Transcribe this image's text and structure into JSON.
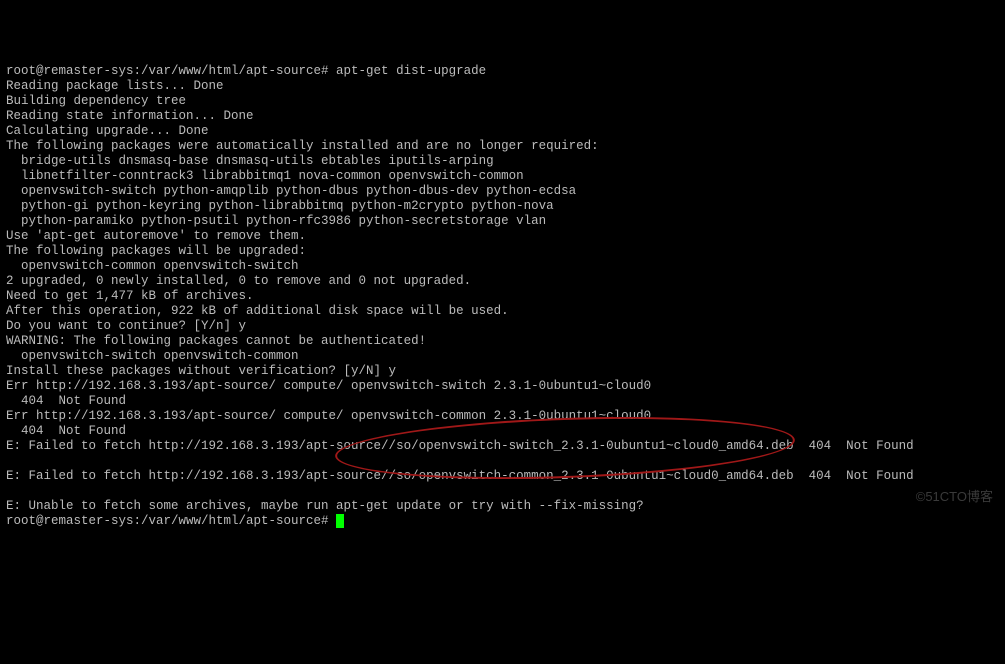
{
  "lines": [
    "root@remaster-sys:/var/www/html/apt-source# apt-get dist-upgrade",
    "Reading package lists... Done",
    "Building dependency tree",
    "Reading state information... Done",
    "Calculating upgrade... Done",
    "The following packages were automatically installed and are no longer required:",
    "  bridge-utils dnsmasq-base dnsmasq-utils ebtables iputils-arping",
    "  libnetfilter-conntrack3 librabbitmq1 nova-common openvswitch-common",
    "  openvswitch-switch python-amqplib python-dbus python-dbus-dev python-ecdsa",
    "  python-gi python-keyring python-librabbitmq python-m2crypto python-nova",
    "  python-paramiko python-psutil python-rfc3986 python-secretstorage vlan",
    "Use 'apt-get autoremove' to remove them.",
    "The following packages will be upgraded:",
    "  openvswitch-common openvswitch-switch",
    "2 upgraded, 0 newly installed, 0 to remove and 0 not upgraded.",
    "Need to get 1,477 kB of archives.",
    "After this operation, 922 kB of additional disk space will be used.",
    "Do you want to continue? [Y/n] y",
    "WARNING: The following packages cannot be authenticated!",
    "  openvswitch-switch openvswitch-common",
    "Install these packages without verification? [y/N] y",
    "Err http://192.168.3.193/apt-source/ compute/ openvswitch-switch 2.3.1-0ubuntu1~cloud0",
    "  404  Not Found",
    "Err http://192.168.3.193/apt-source/ compute/ openvswitch-common 2.3.1-0ubuntu1~cloud0",
    "  404  Not Found",
    "E: Failed to fetch http://192.168.3.193/apt-source//so/openvswitch-switch_2.3.1-0ubuntu1~cloud0_amd64.deb  404  Not Found",
    "",
    "E: Failed to fetch http://192.168.3.193/apt-source//so/openvswitch-common_2.3.1-0ubuntu1~cloud0_amd64.deb  404  Not Found",
    "",
    "E: Unable to fetch some archives, maybe run apt-get update or try with --fix-missing?"
  ],
  "prompt": "root@remaster-sys:/var/www/html/apt-source# ",
  "watermark": "©51CTO博客"
}
